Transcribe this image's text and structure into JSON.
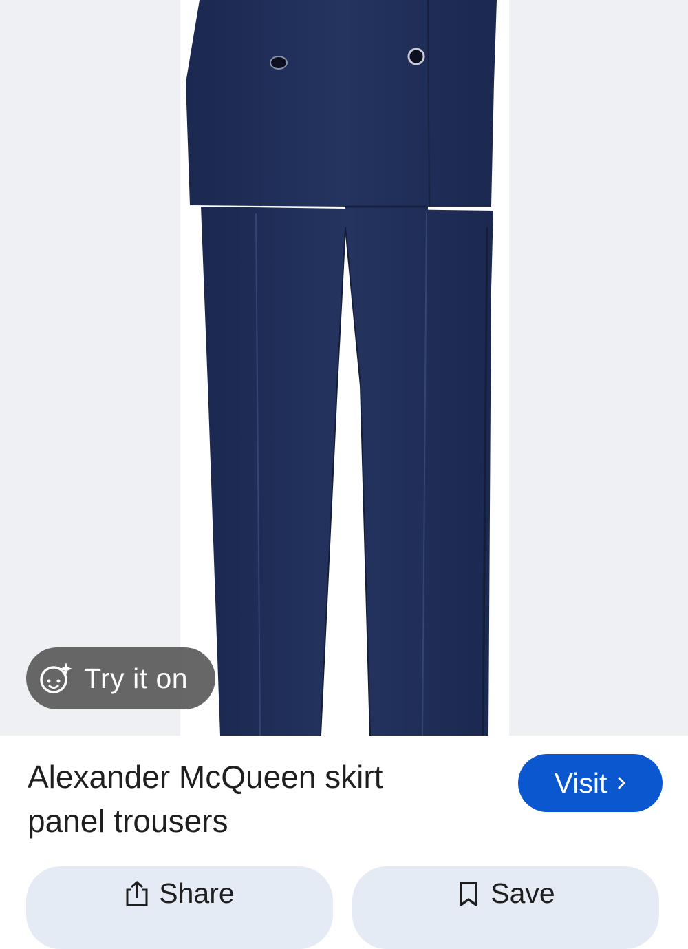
{
  "product": {
    "title": "Alexander McQueen skirt panel trousers"
  },
  "overlay": {
    "try_on_label": "Try it on",
    "try_on_icon": "face-sparkle-icon"
  },
  "buttons": {
    "visit_label": "Visit",
    "visit_icon": "chevron-right-icon",
    "share_label": "Share",
    "share_icon": "share-icon",
    "save_label": "Save",
    "save_icon": "bookmark-icon"
  },
  "colors": {
    "accent": "#0b57d0",
    "pill_bg": "#e4ebf5",
    "garment": "#1f2d57",
    "backdrop": "#eef0f3"
  }
}
